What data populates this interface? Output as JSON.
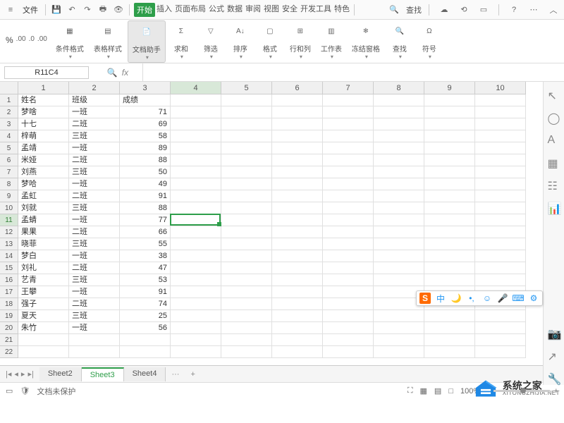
{
  "menubar": {
    "file": "文件",
    "tabs": [
      "开始",
      "插入",
      "页面布局",
      "公式",
      "数据",
      "审阅",
      "视图",
      "安全",
      "开发工具",
      "特色"
    ],
    "active_tab_index": 0,
    "search": "查找"
  },
  "ribbon": {
    "percent": "%",
    "decimal_widgets": [
      ".00",
      ".0",
      ".00"
    ],
    "groups": [
      {
        "label": "条件格式",
        "icon": "grid"
      },
      {
        "label": "表格样式",
        "icon": "table"
      },
      {
        "label": "文档助手",
        "icon": "doc",
        "highlight": true
      },
      {
        "label": "求和",
        "icon": "sigma"
      },
      {
        "label": "筛选",
        "icon": "funnel"
      },
      {
        "label": "排序",
        "icon": "sort"
      },
      {
        "label": "格式",
        "icon": "cell"
      },
      {
        "label": "行和列",
        "icon": "rowcol"
      },
      {
        "label": "工作表",
        "icon": "sheet"
      },
      {
        "label": "冻结窗格",
        "icon": "freeze"
      },
      {
        "label": "查找",
        "icon": "search"
      },
      {
        "label": "符号",
        "icon": "symbol"
      }
    ]
  },
  "namebox": "R11C4",
  "columns": [
    "1",
    "2",
    "3",
    "4",
    "5",
    "6",
    "7",
    "8",
    "9",
    "10"
  ],
  "selected_col_index": 3,
  "selected_row_index": 10,
  "rows": [
    {
      "n": "1",
      "cells": [
        "姓名",
        "班级",
        "成绩"
      ]
    },
    {
      "n": "2",
      "cells": [
        "梦啥",
        "一班",
        "71"
      ]
    },
    {
      "n": "3",
      "cells": [
        "十七",
        "二班",
        "69"
      ]
    },
    {
      "n": "4",
      "cells": [
        "梓萌",
        "三班",
        "58"
      ]
    },
    {
      "n": "5",
      "cells": [
        "孟靖",
        "一班",
        "89"
      ]
    },
    {
      "n": "6",
      "cells": [
        "米娅",
        "二班",
        "88"
      ]
    },
    {
      "n": "7",
      "cells": [
        "刘燕",
        "三班",
        "50"
      ]
    },
    {
      "n": "8",
      "cells": [
        "梦哈",
        "一班",
        "49"
      ]
    },
    {
      "n": "9",
      "cells": [
        "孟虹",
        "二班",
        "91"
      ]
    },
    {
      "n": "10",
      "cells": [
        "刘就",
        "三班",
        "88"
      ]
    },
    {
      "n": "11",
      "cells": [
        "孟蜻",
        "一班",
        "77"
      ]
    },
    {
      "n": "12",
      "cells": [
        "果果",
        "二班",
        "66"
      ]
    },
    {
      "n": "13",
      "cells": [
        "晓菲",
        "三班",
        "55"
      ]
    },
    {
      "n": "14",
      "cells": [
        "梦白",
        "一班",
        "38"
      ]
    },
    {
      "n": "15",
      "cells": [
        "刘礼",
        "二班",
        "47"
      ]
    },
    {
      "n": "16",
      "cells": [
        "艺青",
        "三班",
        "53"
      ]
    },
    {
      "n": "17",
      "cells": [
        "王攀",
        "一班",
        "91"
      ]
    },
    {
      "n": "18",
      "cells": [
        "强子",
        "二班",
        "74"
      ]
    },
    {
      "n": "19",
      "cells": [
        "夏天",
        "三班",
        "25"
      ]
    },
    {
      "n": "20",
      "cells": [
        "朱竹",
        "一班",
        "56"
      ]
    },
    {
      "n": "21",
      "cells": []
    },
    {
      "n": "22",
      "cells": []
    }
  ],
  "sheets": {
    "tabs": [
      "Sheet2",
      "Sheet3",
      "Sheet4"
    ],
    "active_index": 1,
    "more": "···",
    "add": "+"
  },
  "statusbar": {
    "protect": "文档未保护",
    "zoom": "100%"
  },
  "ime": {
    "items": [
      "S",
      "中",
      "🌙",
      "•,",
      "☺",
      "🎤",
      "⌨",
      "⚙"
    ]
  },
  "watermark": {
    "cn": "系统之家",
    "en": "XITONGZHIJIA.NET"
  }
}
